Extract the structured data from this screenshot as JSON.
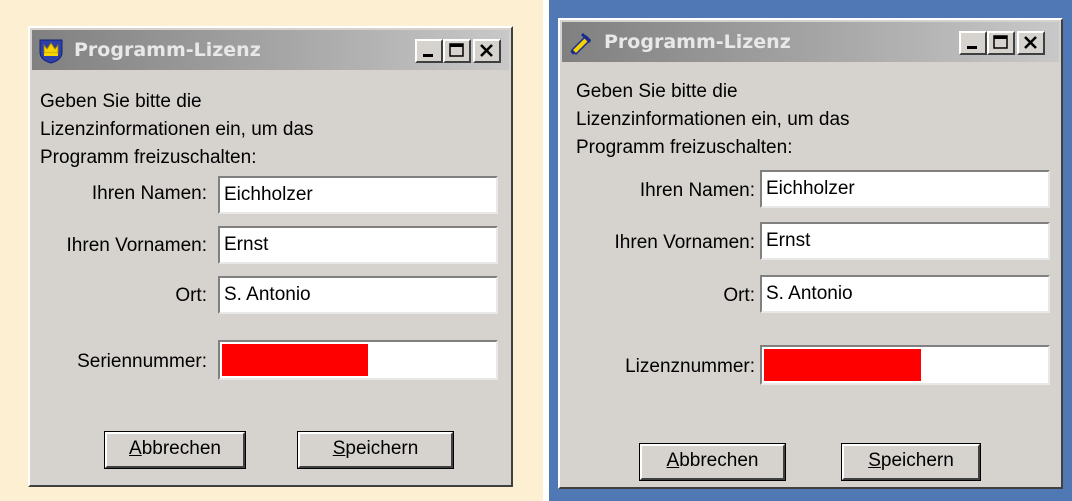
{
  "dialogs": [
    {
      "title": "Programm-Lizenz",
      "intro": [
        "Geben Sie bitte die",
        "Lizenzinformationen ein, um das",
        "Programm freizuschalten:"
      ],
      "fields": {
        "name_label": "Ihren Namen:",
        "name_value": "Eichholzer",
        "vorname_label": "Ihren Vornamen:",
        "vorname_value": "Ernst",
        "ort_label": "Ort:",
        "ort_value": "S. Antonio",
        "serial_label": "Seriennummer:",
        "serial_redacted_fraction": 0.53
      },
      "buttons": {
        "cancel_first": "A",
        "cancel_rest": "bbrechen",
        "save_first": "S",
        "save_rest": "peichern"
      },
      "icon": "crown-shield-icon"
    },
    {
      "title": "Programm-Lizenz",
      "intro": [
        "Geben Sie bitte die",
        "Lizenzinformationen ein, um das",
        "Programm freizuschalten:"
      ],
      "fields": {
        "name_label": "Ihren Namen:",
        "name_value": "Eichholzer",
        "vorname_label": "Ihren Vornamen:",
        "vorname_value": "Ernst",
        "ort_label": "Ort:",
        "ort_value": "S. Antonio",
        "serial_label": "Lizenznummer:",
        "serial_redacted_fraction": 0.55
      },
      "buttons": {
        "cancel_first": "A",
        "cancel_rest": "bbrechen",
        "save_first": "S",
        "save_rest": "peichern"
      },
      "icon": "key-icon"
    }
  ],
  "colors": {
    "left_background": "#fdf0d2",
    "right_background": "#4f78b5",
    "dialog_face": "#d6d3ce",
    "redaction": "#ff0000"
  }
}
